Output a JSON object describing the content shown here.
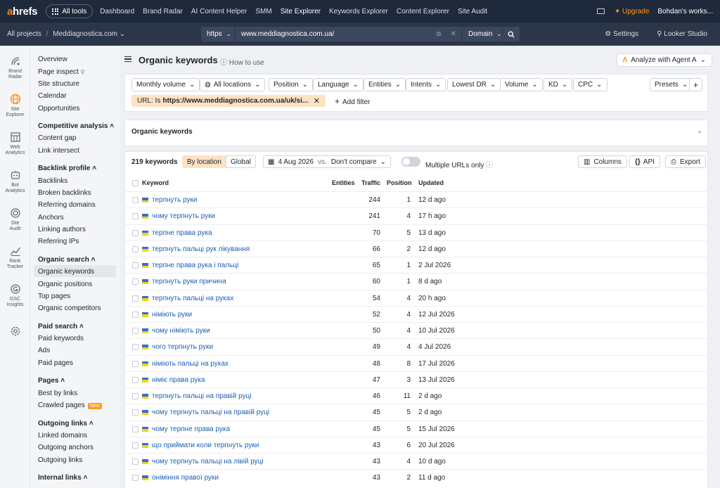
{
  "topbar": {
    "logo_a": "a",
    "logo_rest": "hrefs",
    "all_tools": "All tools",
    "nav": [
      "Dashboard",
      "Brand Radar",
      "AI Content Helper",
      "SMM",
      "Site Explorer",
      "Keywords Explorer",
      "Content Explorer",
      "Site Audit"
    ],
    "active_nav": "Site Explorer",
    "upgrade": "Upgrade",
    "user": "Bohdan's works..."
  },
  "urlbar": {
    "all_projects": "All projects",
    "separator": "/",
    "project": "Meddiagnostica.com",
    "protocol": "https",
    "url": "www.meddiagnostica.com.ua/",
    "mode": "Domain",
    "settings": "Settings",
    "looker": "Looker Studio"
  },
  "rail": [
    {
      "line1": "Brand",
      "line2": "Radar",
      "icon": "brand-radar-icon"
    },
    {
      "line1": "Site",
      "line2": "Explorer",
      "icon": "site-explorer-icon"
    },
    {
      "line1": "Web",
      "line2": "Analytics",
      "icon": "web-analytics-icon"
    },
    {
      "line1": "Bot",
      "line2": "Analytics",
      "icon": "bot-analytics-icon"
    },
    {
      "line1": "Site",
      "line2": "Audit",
      "icon": "site-audit-icon"
    },
    {
      "line1": "Rank",
      "line2": "Tracker",
      "icon": "rank-tracker-icon"
    },
    {
      "line1": "GSC",
      "line2": "Insights",
      "icon": "gsc-insights-icon"
    }
  ],
  "sidebar": {
    "overview": "Overview",
    "page_inspect": "Page inspect",
    "site_structure": "Site structure",
    "calendar": "Calendar",
    "opportunities": "Opportunities",
    "competitive_analysis": "Competitive analysis",
    "content_gap": "Content gap",
    "link_intersect": "Link intersect",
    "backlink_profile": "Backlink profile",
    "backlinks": "Backlinks",
    "broken_backlinks": "Broken backlinks",
    "referring_domains": "Referring domains",
    "anchors": "Anchors",
    "linking_authors": "Linking authors",
    "referring_ips": "Referring IPs",
    "organic_search": "Organic search",
    "organic_keywords": "Organic keywords",
    "organic_positions": "Organic positions",
    "top_pages": "Top pages",
    "organic_competitors": "Organic competitors",
    "paid_search": "Paid search",
    "paid_keywords": "Paid keywords",
    "ads": "Ads",
    "paid_pages": "Paid pages",
    "pages": "Pages",
    "best_by_links": "Best by links",
    "crawled_pages": "Crawled pages",
    "new_badge": "New",
    "outgoing_links": "Outgoing links",
    "linked_domains": "Linked domains",
    "outgoing_anchors": "Outgoing anchors",
    "outgoing_links_item": "Outgoing links",
    "internal_links": "Internal links"
  },
  "main": {
    "title": "Organic keywords",
    "how_to_use": "How to use",
    "agent": "Analyze with Agent A",
    "filters": [
      "Monthly volume",
      "All locations",
      "Position",
      "Language",
      "Entities",
      "Intents",
      "Lowest DR",
      "Volume",
      "KD",
      "CPC"
    ],
    "presets": "Presets",
    "url_filter_label": "URL: Is",
    "url_filter_value": "https://www.meddiagnostica.com.ua/uk/si...",
    "add_filter": "Add filter",
    "collapsed_title": "Organic keywords"
  },
  "table": {
    "count": "219 keywords",
    "by_location": "By location",
    "global": "Global",
    "date": "4 Aug 2026",
    "vs": "vs.",
    "compare": "Don't compare",
    "multiple_urls": "Multiple URLs only",
    "columns": "Columns",
    "api": "API",
    "export": "Export",
    "headers": {
      "keyword": "Keyword",
      "entities": "Entities",
      "traffic": "Traffic",
      "position": "Position",
      "updated": "Updated"
    },
    "rows": [
      {
        "kw": "терпнуть руки",
        "traffic": "244",
        "pos": "1",
        "updated": "12 d ago"
      },
      {
        "kw": "чому терпнуть руки",
        "traffic": "241",
        "pos": "4",
        "updated": "17 h ago"
      },
      {
        "kw": "терпне права рука",
        "traffic": "70",
        "pos": "5",
        "updated": "13 d ago"
      },
      {
        "kw": "терпнуть пальці рук лікування",
        "traffic": "66",
        "pos": "2",
        "updated": "12 d ago"
      },
      {
        "kw": "терпне права рука і пальці",
        "traffic": "65",
        "pos": "1",
        "updated": "2 Jul 2026"
      },
      {
        "kw": "терпнуть руки причина",
        "traffic": "60",
        "pos": "1",
        "updated": "8 d ago"
      },
      {
        "kw": "терпнуть пальці на руках",
        "traffic": "54",
        "pos": "4",
        "updated": "20 h ago"
      },
      {
        "kw": "німіють руки",
        "traffic": "52",
        "pos": "4",
        "updated": "12 Jul 2026"
      },
      {
        "kw": "чому німіють руки",
        "traffic": "50",
        "pos": "4",
        "updated": "10 Jul 2026"
      },
      {
        "kw": "чого терпнуть руки",
        "traffic": "49",
        "pos": "4",
        "updated": "4 Jul 2026"
      },
      {
        "kw": "німіють пальці на руках",
        "traffic": "48",
        "pos": "8",
        "updated": "17 Jul 2026"
      },
      {
        "kw": "німіє права рука",
        "traffic": "47",
        "pos": "3",
        "updated": "13 Jul 2026"
      },
      {
        "kw": "терпнуть пальці на правій руці",
        "traffic": "46",
        "pos": "11",
        "updated": "2 d ago"
      },
      {
        "kw": "чому терпнуть пальці на правій руці",
        "traffic": "45",
        "pos": "5",
        "updated": "2 d ago"
      },
      {
        "kw": "чому терпне права рука",
        "traffic": "45",
        "pos": "5",
        "updated": "15 Jul 2026"
      },
      {
        "kw": "що приймати коли терпнуть руки",
        "traffic": "43",
        "pos": "6",
        "updated": "20 Jul 2026"
      },
      {
        "kw": "чому терпнуть пальці на лівій руці",
        "traffic": "43",
        "pos": "4",
        "updated": "10 d ago"
      },
      {
        "kw": "оніміння правої руки",
        "traffic": "43",
        "pos": "2",
        "updated": "11 d ago"
      }
    ]
  },
  "colors": {
    "brand_orange": "#ff8800",
    "topbar": "#1e2a3b",
    "link": "#1a5fb4",
    "flag_blue": "#2f6fd6",
    "flag_yellow": "#f5d300"
  }
}
